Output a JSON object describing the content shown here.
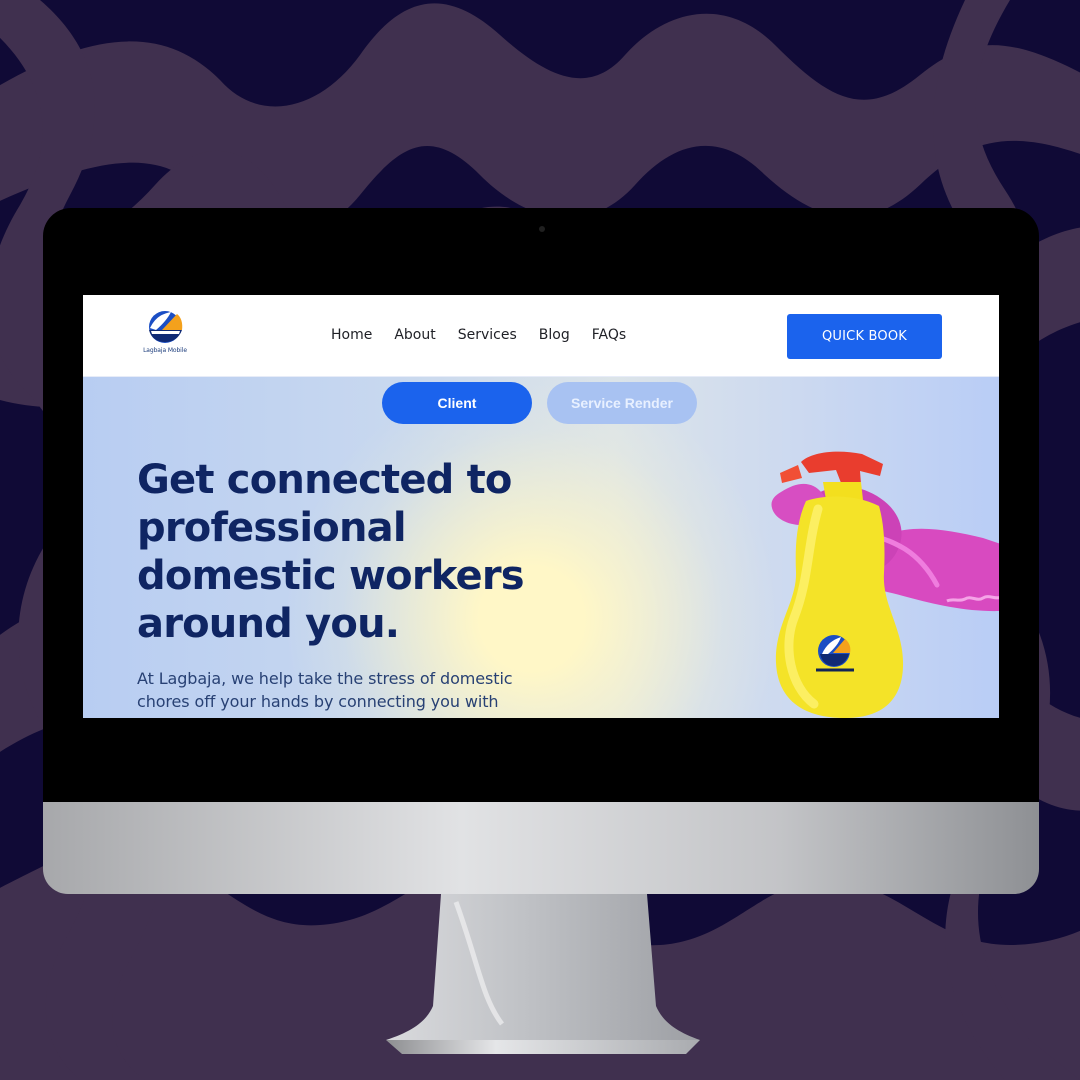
{
  "brand": {
    "name": "Lagbaja Mobile"
  },
  "navigation": {
    "items": [
      "Home",
      "About",
      "Services",
      "Blog",
      "FAQs"
    ],
    "quick_book": "QUICK BOOK"
  },
  "hero": {
    "toggle_client": "Client",
    "toggle_service_render": "Service Render",
    "headline": "Get connected to professional domestic workers around you.",
    "description": "At Lagbaja, we help take the stress of domestic chores off your hands by connecting you with"
  },
  "colors": {
    "background": "#100a36",
    "background_wave": "#40304f",
    "primary_blue": "#1b63ed",
    "headline_navy": "#0f2563",
    "glove_pink": "#d34bbf",
    "bottle_yellow": "#f4e328",
    "nozzle_red": "#e83b2d",
    "logo_orange": "#f4a11c"
  },
  "icons": {
    "brand_logo": "orange-blue-sail-logo",
    "product_image": "spray-bottle-with-pink-glove"
  }
}
